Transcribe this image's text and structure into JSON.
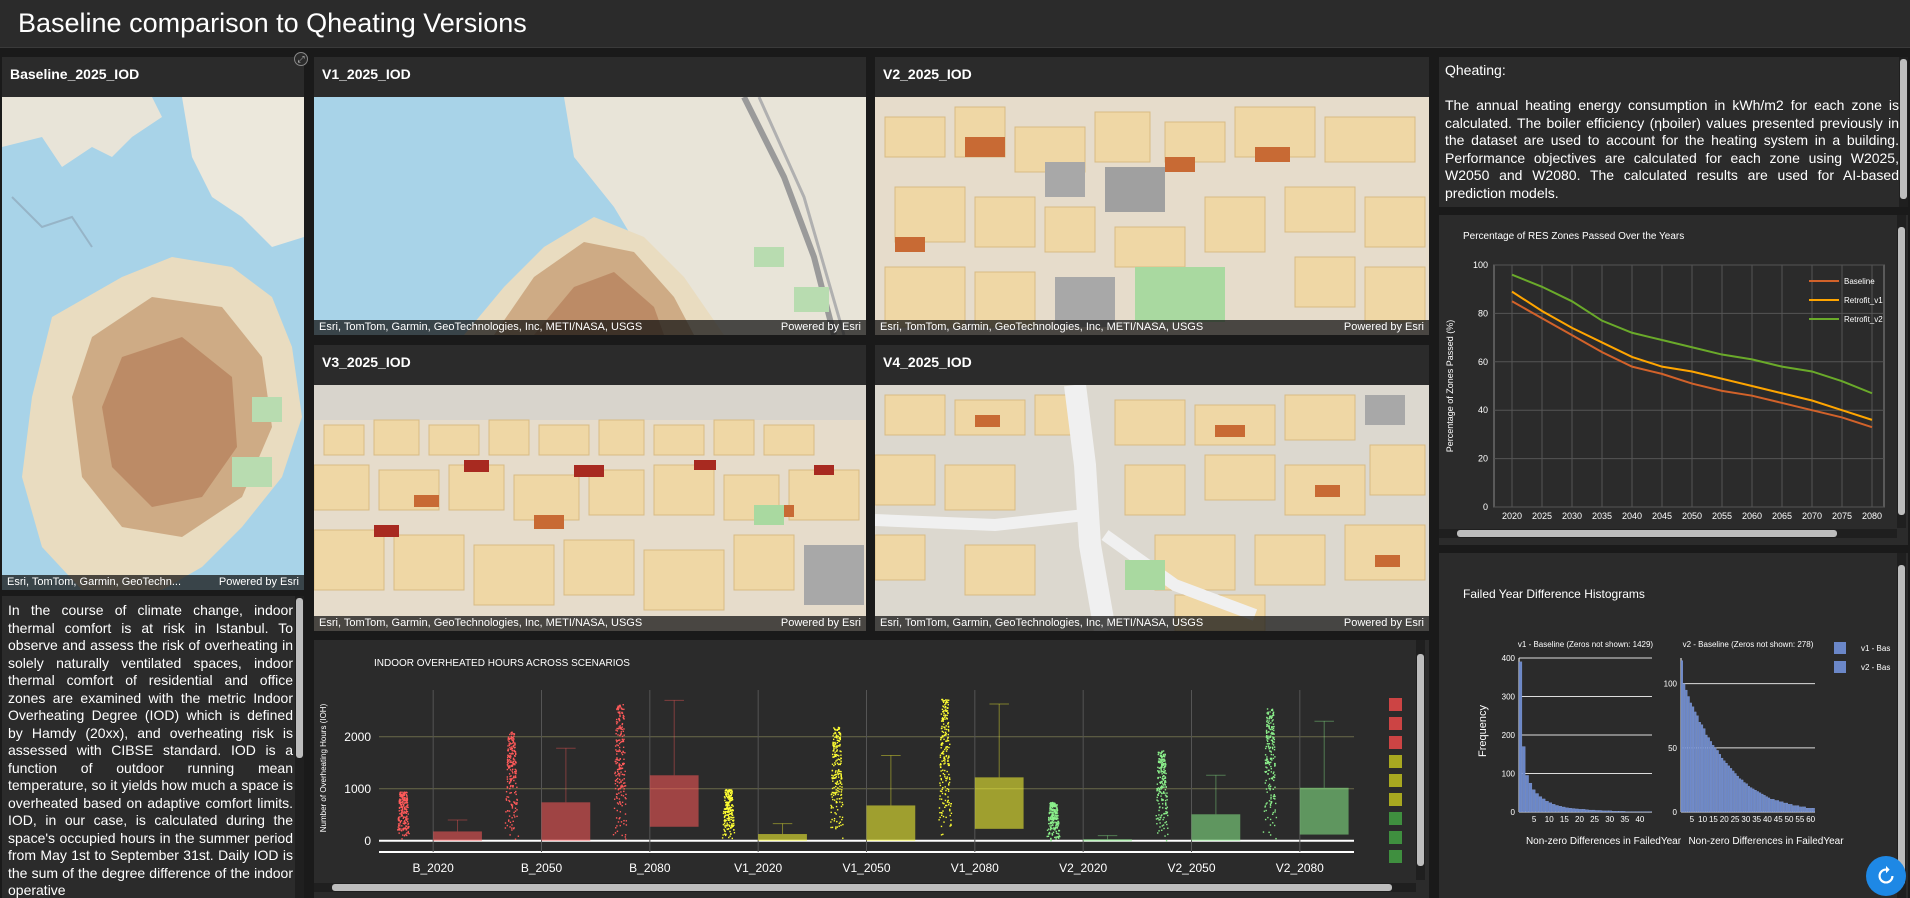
{
  "header": {
    "title": "Baseline comparison to Qheating Versions"
  },
  "maps": {
    "baseline": {
      "title": "Baseline_2025_IOD",
      "attribution": "Esri, TomTom, Garmin, GeoTechn...",
      "powered": "Powered by Esri"
    },
    "v1": {
      "title": "V1_2025_IOD",
      "attribution": "Esri, TomTom, Garmin, GeoTechnologies, Inc, METI/NASA, USGS",
      "powered": "Powered by Esri"
    },
    "v2": {
      "title": "V2_2025_IOD",
      "attribution": "Esri, TomTom, Garmin, GeoTechnologies, Inc, METI/NASA, USGS",
      "powered": "Powered by Esri"
    },
    "v3": {
      "title": "V3_2025_IOD",
      "attribution": "Esri, TomTom, Garmin, GeoTechnologies, Inc, METI/NASA, USGS",
      "powered": "Powered by Esri"
    },
    "v4": {
      "title": "V4_2025_IOD",
      "attribution": "Esri, TomTom, Garmin, GeoTechnologies, Inc, METI/NASA, USGS",
      "powered": "Powered by Esri"
    }
  },
  "iod_text": "In the course of climate change, indoor thermal comfort is at risk in Istanbul. To observe and assess the risk of overheating in solely naturally ventilated spaces, indoor thermal comfort of residential and office zones are examined with the metric Indoor Overheating Degree (IOD) which is defined by Hamdy (20xx), and overheating risk is assessed with CIBSE standard. IOD is a function of outdoor running mean temperature, so it yields how much a space is overheated based on adaptive comfort limits. IOD, in our case, is calculated during the space's occupied hours in the summer period from May 1st to September 31st. Daily IOD is the sum of the degree difference of the indoor operative",
  "qheating": {
    "heading": "Qheating:",
    "body": "The annual heating energy consumption in kWh/m2 for each zone is calculated. The boiler efficiency (ηboiler) values presented previously in the dataset are used to account for the heating system in a building.  Performance objectives are calculated for each zone using W2025, W2050 and W2080. The calculated results are used for AI-based prediction models."
  },
  "chart_data": [
    {
      "type": "box",
      "title": "INDOOR OVERHEATED HOURS ACROSS SCENARIOS",
      "ylabel": "Number of Overheating Hours (IOH)",
      "xlabel": "",
      "ylim": [
        -100,
        2900
      ],
      "yticks": [
        0,
        1000,
        2000
      ],
      "categories": [
        "B_2020",
        "B_2050",
        "B_2080",
        "V1_2020",
        "V1_2050",
        "V1_2080",
        "V2_2020",
        "V2_2050",
        "V2_2080"
      ],
      "boxes": [
        {
          "q1": 0,
          "q3": 180,
          "max": 400,
          "point_max": 950,
          "point_min": 0,
          "color": "#ff5a5a"
        },
        {
          "q1": 0,
          "q3": 740,
          "max": 1780,
          "point_max": 2100,
          "point_min": 0,
          "color": "#ff5a5a"
        },
        {
          "q1": 270,
          "q3": 1260,
          "max": 2700,
          "point_max": 2650,
          "point_min": 0,
          "color": "#ff5a5a"
        },
        {
          "q1": 0,
          "q3": 130,
          "max": 330,
          "point_max": 1000,
          "point_min": 0,
          "color": "#ffff33"
        },
        {
          "q1": 0,
          "q3": 680,
          "max": 1640,
          "point_max": 2200,
          "point_min": 0,
          "color": "#ffff33"
        },
        {
          "q1": 230,
          "q3": 1220,
          "max": 2630,
          "point_max": 2750,
          "point_min": 0,
          "color": "#ffff33"
        },
        {
          "q1": 0,
          "q3": 30,
          "max": 100,
          "point_max": 750,
          "point_min": 0,
          "color": "#8bef8b"
        },
        {
          "q1": 0,
          "q3": 510,
          "max": 1260,
          "point_max": 1750,
          "point_min": 0,
          "color": "#8bef8b"
        },
        {
          "q1": 120,
          "q3": 1020,
          "max": 2300,
          "point_max": 2550,
          "point_min": 0,
          "color": "#8bef8b"
        }
      ],
      "legend_colors": [
        "#cc4444",
        "#cc4444",
        "#cc4444",
        "#a8a820",
        "#a8a820",
        "#a8a820",
        "#3f8f3f",
        "#3f8f3f",
        "#3f8f3f"
      ]
    },
    {
      "type": "line",
      "title": "Percentage of RES Zones Passed Over the Years",
      "ylabel": "Percentage of Zones Passed (%)",
      "xlabel": "",
      "ylim": [
        0,
        100
      ],
      "yticks": [
        0,
        20,
        40,
        60,
        80,
        100
      ],
      "x": [
        2020,
        2025,
        2030,
        2035,
        2040,
        2045,
        2050,
        2055,
        2060,
        2065,
        2070,
        2075,
        2080
      ],
      "series": [
        {
          "name": "Baseline",
          "color": "#d2622a",
          "values": [
            85,
            78,
            71,
            64,
            58,
            55,
            51,
            48,
            46,
            43,
            40,
            37,
            33
          ]
        },
        {
          "name": "Retrofit_v1",
          "color": "#ffa500",
          "values": [
            89,
            81,
            74,
            68,
            62,
            58,
            56,
            53,
            50,
            47,
            44,
            40,
            36
          ]
        },
        {
          "name": "Retrofit_v2",
          "color": "#6aaa2a",
          "values": [
            96,
            91,
            85,
            77,
            72,
            69,
            66,
            63,
            61,
            58,
            56,
            52,
            47
          ]
        }
      ]
    },
    {
      "type": "histogram",
      "title": "Failed Year Difference Histograms",
      "ylabel": "Frequency",
      "panels": [
        {
          "subtitle": "v1 - Baseline (Zeros not shown: 1429)",
          "xlabel": "Non-zero Differences in FailedYear",
          "ylim": [
            0,
            400
          ],
          "yticks": [
            0,
            100,
            200,
            300,
            400
          ],
          "xticks": [
            5,
            10,
            15,
            20,
            25,
            30,
            35,
            40
          ],
          "xlim": [
            0,
            44
          ],
          "counts": [
            390,
            170,
            95,
            75,
            58,
            48,
            40,
            34,
            28,
            24,
            20,
            17,
            15,
            13,
            11,
            10,
            9,
            8,
            7,
            7,
            6,
            5,
            5,
            4,
            4,
            3,
            3,
            3,
            2,
            2,
            2,
            2,
            1,
            1,
            1,
            1,
            1,
            1,
            1,
            1
          ]
        },
        {
          "subtitle": "v2 - Baseline (Zeros not shown: 278)",
          "xlabel": "Non-zero Differences in FailedYear",
          "ylim": [
            0,
            120
          ],
          "yticks": [
            0,
            50,
            100
          ],
          "xticks": [
            5,
            10,
            15,
            20,
            25,
            30,
            35,
            40,
            45,
            50,
            55,
            60
          ],
          "xlim": [
            0,
            62
          ],
          "counts": [
            118,
            100,
            95,
            90,
            85,
            82,
            78,
            75,
            70,
            68,
            65,
            60,
            58,
            55,
            52,
            50,
            48,
            45,
            42,
            40,
            38,
            36,
            34,
            32,
            30,
            28,
            26,
            25,
            23,
            22,
            20,
            19,
            18,
            17,
            16,
            15,
            14,
            13,
            12,
            11,
            10,
            10,
            9,
            9,
            8,
            8,
            7,
            7,
            6,
            6,
            5,
            5,
            5,
            4,
            4,
            4,
            3,
            3,
            3,
            3
          ]
        }
      ],
      "legend": [
        "v1 - Bas",
        "v2 - Bas"
      ],
      "legend_color": "#6b87c8"
    }
  ]
}
